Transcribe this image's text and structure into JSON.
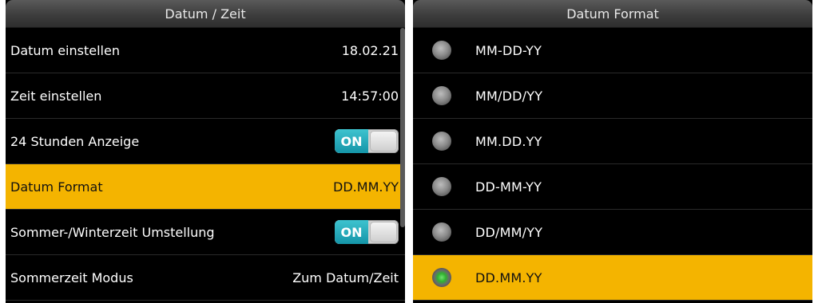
{
  "left_panel": {
    "title": "Datum / Zeit",
    "rows": [
      {
        "label": "Datum einstellen",
        "value": "18.02.21"
      },
      {
        "label": "Zeit einstellen",
        "value": "14:57:00"
      },
      {
        "label": "24 Stunden Anzeige",
        "toggle": "ON"
      },
      {
        "label": "Datum Format",
        "value": "DD.MM.YY",
        "selected": true
      },
      {
        "label": "Sommer-/Winterzeit Umstellung",
        "toggle": "ON"
      },
      {
        "label": "Sommerzeit Modus",
        "value": "Zum Datum/Zeit"
      }
    ]
  },
  "right_panel": {
    "title": "Datum Format",
    "options": [
      {
        "label": "MM-DD-YY"
      },
      {
        "label": "MM/DD/YY"
      },
      {
        "label": "MM.DD.YY"
      },
      {
        "label": "DD-MM-YY"
      },
      {
        "label": "DD/MM/YY"
      },
      {
        "label": "DD.MM.YY",
        "selected": true
      }
    ]
  },
  "colors": {
    "highlight": "#f4b400",
    "background": "#000000",
    "toggle_on": "#1ba6b8",
    "radio_checked": "#2fb32f"
  }
}
